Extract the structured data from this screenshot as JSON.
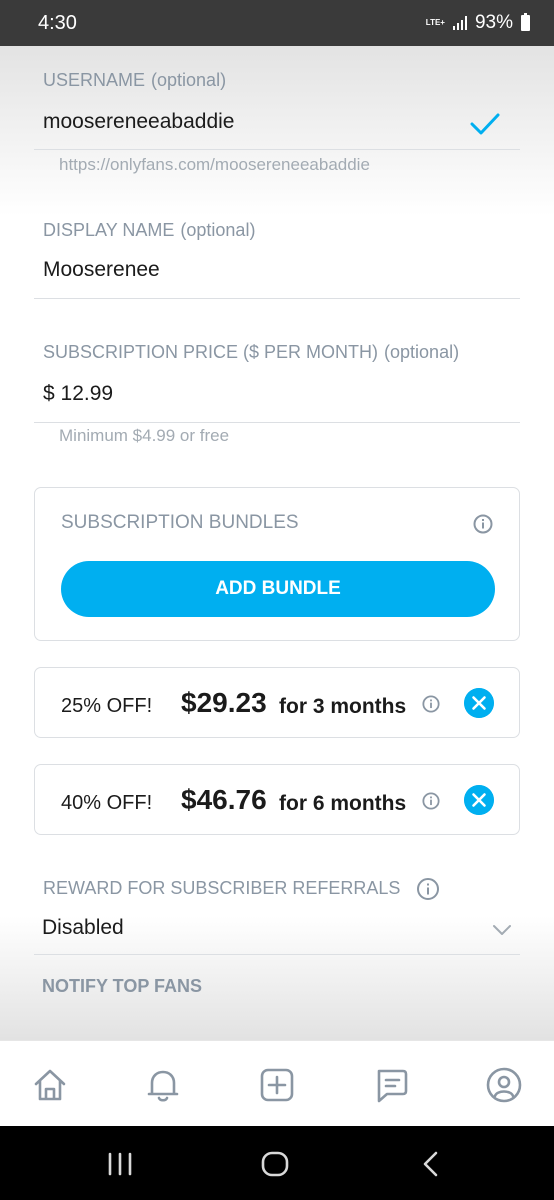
{
  "status_bar": {
    "time": "4:30",
    "network": "LTE+",
    "battery": "93%"
  },
  "form": {
    "username": {
      "label": "USERNAME",
      "optional": "(optional)",
      "value": "moosereneeabaddie",
      "url": "https://onlyfans.com/moosereneeabaddie"
    },
    "display_name": {
      "label": "DISPLAY NAME",
      "optional": "(optional)",
      "value": "Mooserenee"
    },
    "subscription_price": {
      "label": "SUBSCRIPTION PRICE ($ PER MONTH)",
      "optional": "(optional)",
      "value": "$ 12.99",
      "hint": "Minimum $4.99 or free"
    },
    "subscription_bundles": {
      "title": "SUBSCRIPTION BUNDLES",
      "add_button": "ADD BUNDLE",
      "items": [
        {
          "discount": "25% OFF!",
          "price": "$29.23",
          "duration": "for 3 months"
        },
        {
          "discount": "40% OFF!",
          "price": "$46.76",
          "duration": "for 6 months"
        }
      ]
    },
    "referral_reward": {
      "label": "REWARD FOR SUBSCRIBER REFERRALS",
      "value": "Disabled"
    },
    "next_section_label": "NOTIFY TOP FANS"
  },
  "bottom_nav": {
    "items": [
      "home-icon",
      "bell-icon",
      "add-post-icon",
      "messages-icon",
      "profile-icon"
    ]
  },
  "colors": {
    "accent": "#00aff0",
    "label": "#8a96a3",
    "text": "#1b1b1b"
  }
}
